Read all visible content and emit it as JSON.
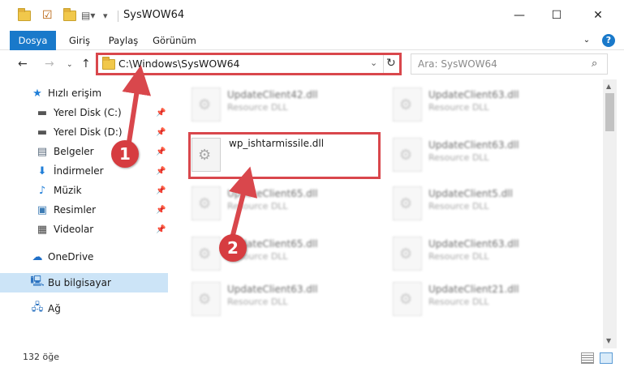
{
  "window": {
    "title": "SysWOW64",
    "minimize": "—",
    "maximize": "☐",
    "close": "✕"
  },
  "ribbon": {
    "tabs": [
      "Dosya",
      "Giriş",
      "Paylaş",
      "Görünüm"
    ],
    "help": "?"
  },
  "address": {
    "path": "C:\\Windows\\SysWOW64",
    "search_placeholder": "Ara: SysWOW64"
  },
  "nav": {
    "quick_access": "Hızlı erişim",
    "items": [
      "Yerel Disk (C:)",
      "Yerel Disk (D:)",
      "Belgeler",
      "İndirmeler",
      "Müzik",
      "Resimler",
      "Videolar"
    ],
    "onedrive": "OneDrive",
    "this_pc": "Bu bilgisayar",
    "network": "Ağ"
  },
  "files": [
    {
      "name": "UpdateClient42.dll",
      "type": "Resource DLL"
    },
    {
      "name": "UpdateClient63.dll",
      "type": "Resource DLL"
    },
    {
      "name": "wp_ishtarmissile.dll",
      "type": ""
    },
    {
      "name": "UpdateClient63.dll",
      "type": "Resource DLL"
    },
    {
      "name": "UpdateClient65.dll",
      "type": "Resource DLL"
    },
    {
      "name": "UpdateClient5.dll",
      "type": "Resource DLL"
    },
    {
      "name": "UpdateClient65.dll",
      "type": "Resource DLL"
    },
    {
      "name": "UpdateClient63.dll",
      "type": "Resource DLL"
    },
    {
      "name": "UpdateClient63.dll",
      "type": "Resource DLL"
    },
    {
      "name": "UpdateClient21.dll",
      "type": "Resource DLL"
    }
  ],
  "status": {
    "count": "132 öğe"
  },
  "annotations": {
    "step1": "1",
    "step2": "2"
  },
  "colors": {
    "accent": "#1979ca",
    "highlight": "#d9474c",
    "selection": "#cce4f7"
  }
}
